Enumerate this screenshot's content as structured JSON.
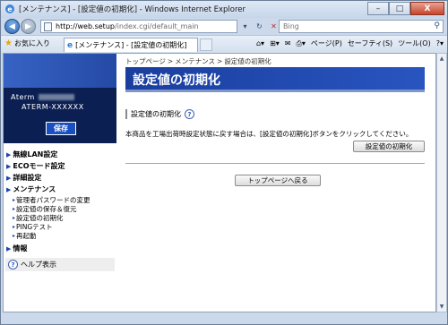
{
  "window": {
    "title": "[メンテナンス] - [設定値の初期化] - Windows Internet Explorer",
    "minimize": "–",
    "maximize": "□",
    "close": "X"
  },
  "address_bar": {
    "url_host": "http://web.setup",
    "url_path": "/index.cgi/default_main",
    "search_placeholder": "Bing",
    "back_icon": "back-arrow-icon",
    "forward_icon": "forward-arrow-icon"
  },
  "favorites_bar": {
    "favorites_label": "お気に入り",
    "tab_title": "[メンテナンス] - [設定値の初期化]",
    "page_menu": "ページ(P)",
    "safety_menu": "セーフティ(S)",
    "tools_menu": "ツール(O)"
  },
  "sidebar": {
    "brand_prefix": "Aterm",
    "model": "ATERM-XXXXXX",
    "save_label": "保存",
    "menu": {
      "wireless_lan": "無線LAN設定",
      "eco_mode": "ECOモード設定",
      "advanced": "詳細設定",
      "maintenance": "メンテナンス",
      "maintenance_items": [
        "管理者パスワードの変更",
        "設定値の保存＆復元",
        "設定値の初期化",
        "PINGテスト",
        "再起動"
      ],
      "info": "情報"
    },
    "help_label": "ヘルプ表示"
  },
  "main": {
    "breadcrumb": [
      "トップページ",
      "メンテナンス",
      "設定値の初期化"
    ],
    "breadcrumb_sep": ">",
    "page_title": "設定値の初期化",
    "section_title": "設定値の初期化",
    "description": "本商品を工場出荷時設定状態に戻す場合は、[設定値の初期化]ボタンをクリックしてください。",
    "init_button": "設定値の初期化",
    "back_button": "トップページへ戻る"
  },
  "colors": {
    "header_blue": "#1a3e9e",
    "brand_navy": "#0b1f52",
    "save_blue": "#1a4fc2"
  }
}
